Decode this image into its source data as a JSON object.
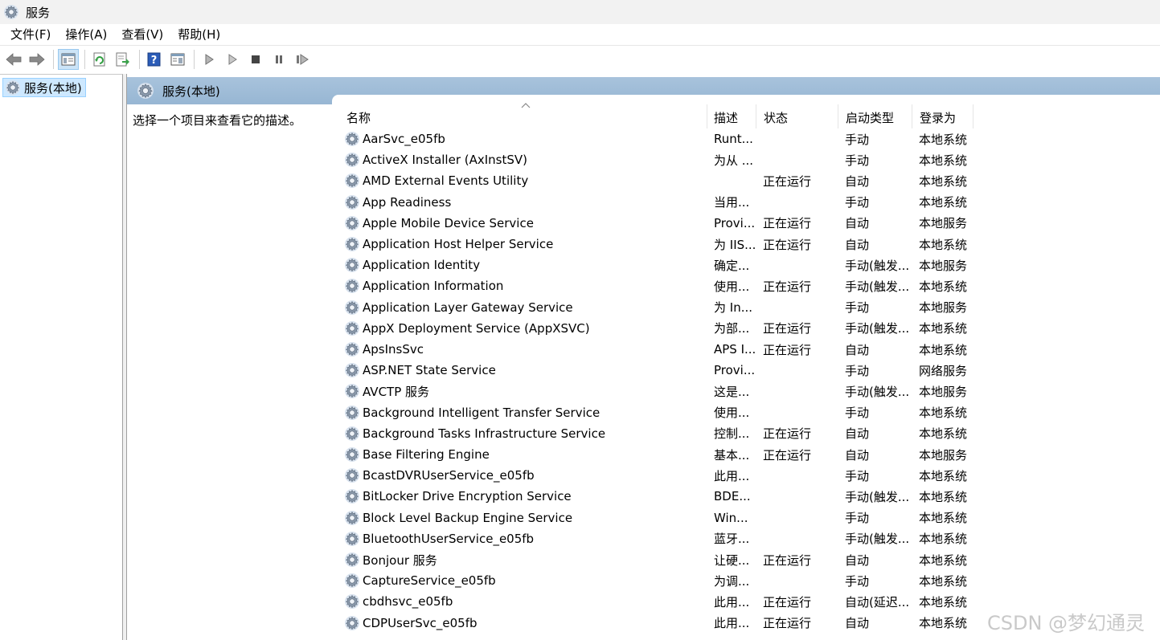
{
  "window": {
    "title": "服务"
  },
  "menu": [
    "文件(F)",
    "操作(A)",
    "查看(V)",
    "帮助(H)"
  ],
  "toolbar": {
    "buttons": [
      "back-icon",
      "forward-icon",
      "show-hide-tree-icon",
      "refresh-icon",
      "export-list-icon",
      "help-icon",
      "properties-icon",
      "start-service-icon",
      "start-service-alt-icon",
      "stop-service-icon",
      "pause-service-icon",
      "restart-service-icon"
    ]
  },
  "tree": {
    "root_label": "服务(本地)"
  },
  "pane": {
    "header": "服务(本地)",
    "description_hint": "选择一个项目来查看它的描述。"
  },
  "columns": {
    "name": "名称",
    "description": "描述",
    "status": "状态",
    "startup_type": "启动类型",
    "logon_as": "登录为"
  },
  "services": [
    {
      "name": "AarSvc_e05fb",
      "desc": "Runt...",
      "status": "",
      "start": "手动",
      "logon": "本地系统"
    },
    {
      "name": "ActiveX Installer (AxInstSV)",
      "desc": "为从 ...",
      "status": "",
      "start": "手动",
      "logon": "本地系统"
    },
    {
      "name": "AMD External Events Utility",
      "desc": "",
      "status": "正在运行",
      "start": "自动",
      "logon": "本地系统"
    },
    {
      "name": "App Readiness",
      "desc": "当用...",
      "status": "",
      "start": "手动",
      "logon": "本地系统"
    },
    {
      "name": "Apple Mobile Device Service",
      "desc": "Provi...",
      "status": "正在运行",
      "start": "自动",
      "logon": "本地服务"
    },
    {
      "name": "Application Host Helper Service",
      "desc": "为 IIS...",
      "status": "正在运行",
      "start": "自动",
      "logon": "本地系统"
    },
    {
      "name": "Application Identity",
      "desc": "确定...",
      "status": "",
      "start": "手动(触发...",
      "logon": "本地服务"
    },
    {
      "name": "Application Information",
      "desc": "使用...",
      "status": "正在运行",
      "start": "手动(触发...",
      "logon": "本地系统"
    },
    {
      "name": "Application Layer Gateway Service",
      "desc": "为 In...",
      "status": "",
      "start": "手动",
      "logon": "本地服务"
    },
    {
      "name": "AppX Deployment Service (AppXSVC)",
      "desc": "为部...",
      "status": "正在运行",
      "start": "手动(触发...",
      "logon": "本地系统"
    },
    {
      "name": "ApsInsSvc",
      "desc": "APS I...",
      "status": "正在运行",
      "start": "自动",
      "logon": "本地系统"
    },
    {
      "name": "ASP.NET State Service",
      "desc": "Provi...",
      "status": "",
      "start": "手动",
      "logon": "网络服务"
    },
    {
      "name": "AVCTP 服务",
      "desc": "这是...",
      "status": "",
      "start": "手动(触发...",
      "logon": "本地服务"
    },
    {
      "name": "Background Intelligent Transfer Service",
      "desc": "使用...",
      "status": "",
      "start": "手动",
      "logon": "本地系统"
    },
    {
      "name": "Background Tasks Infrastructure Service",
      "desc": "控制...",
      "status": "正在运行",
      "start": "自动",
      "logon": "本地系统"
    },
    {
      "name": "Base Filtering Engine",
      "desc": "基本...",
      "status": "正在运行",
      "start": "自动",
      "logon": "本地服务"
    },
    {
      "name": "BcastDVRUserService_e05fb",
      "desc": "此用...",
      "status": "",
      "start": "手动",
      "logon": "本地系统"
    },
    {
      "name": "BitLocker Drive Encryption Service",
      "desc": "BDE...",
      "status": "",
      "start": "手动(触发...",
      "logon": "本地系统"
    },
    {
      "name": "Block Level Backup Engine Service",
      "desc": "Win...",
      "status": "",
      "start": "手动",
      "logon": "本地系统"
    },
    {
      "name": "BluetoothUserService_e05fb",
      "desc": "蓝牙...",
      "status": "",
      "start": "手动(触发...",
      "logon": "本地系统"
    },
    {
      "name": "Bonjour 服务",
      "desc": "让硬...",
      "status": "正在运行",
      "start": "自动",
      "logon": "本地系统"
    },
    {
      "name": "CaptureService_e05fb",
      "desc": "为调...",
      "status": "",
      "start": "手动",
      "logon": "本地系统"
    },
    {
      "name": "cbdhsvc_e05fb",
      "desc": "此用...",
      "status": "正在运行",
      "start": "自动(延迟...",
      "logon": "本地系统"
    },
    {
      "name": "CDPUserSvc_e05fb",
      "desc": "此用...",
      "status": "正在运行",
      "start": "自动",
      "logon": "本地系统"
    }
  ],
  "watermark": "CSDN @梦幻通灵"
}
